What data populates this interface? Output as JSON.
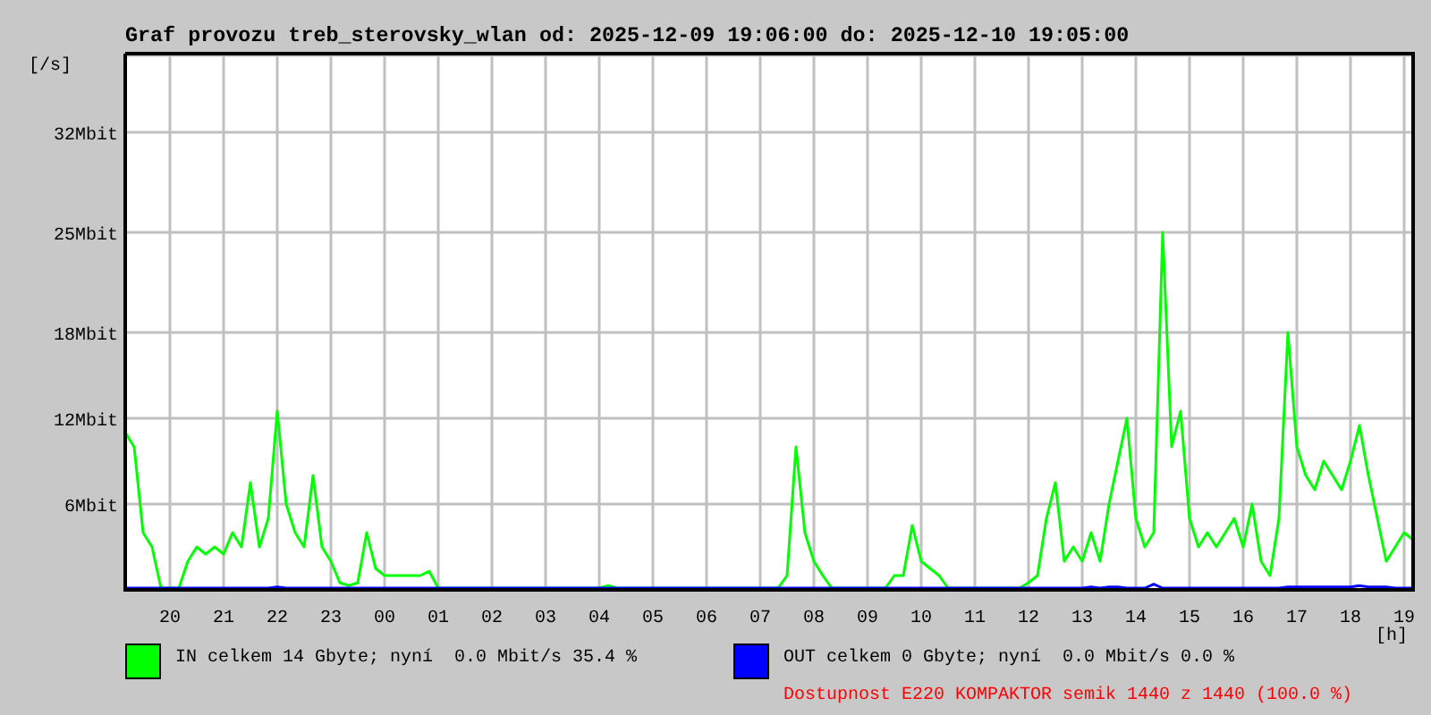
{
  "title": "Graf provozu treb_sterovsky_wlan od: 2025-12-09 19:06:00 do: 2025-12-10 19:05:00",
  "chart": {
    "chart_data": {
      "type": "line",
      "ylabel": "[/s]",
      "xlabel": "[h]",
      "ylim": [
        0,
        37.5
      ],
      "grid": true,
      "yticks": [
        {
          "value": 6,
          "label": "6Mbit"
        },
        {
          "value": 12,
          "label": "12Mbit"
        },
        {
          "value": 18,
          "label": "18Mbit"
        },
        {
          "value": 25,
          "label": "25Mbit"
        },
        {
          "value": 32,
          "label": "32Mbit"
        }
      ],
      "categories": [
        null,
        null,
        null,
        null,
        null,
        "20",
        null,
        null,
        null,
        null,
        null,
        "21",
        null,
        null,
        null,
        null,
        null,
        "22",
        null,
        null,
        null,
        null,
        null,
        "23",
        null,
        null,
        null,
        null,
        null,
        "00",
        null,
        null,
        null,
        null,
        null,
        "01",
        null,
        null,
        null,
        null,
        null,
        "02",
        null,
        null,
        null,
        null,
        null,
        "03",
        null,
        null,
        null,
        null,
        null,
        "04",
        null,
        null,
        null,
        null,
        null,
        "05",
        null,
        null,
        null,
        null,
        null,
        "06",
        null,
        null,
        null,
        null,
        null,
        "07",
        null,
        null,
        null,
        null,
        null,
        "08",
        null,
        null,
        null,
        null,
        null,
        "09",
        null,
        null,
        null,
        null,
        null,
        "10",
        null,
        null,
        null,
        null,
        null,
        "11",
        null,
        null,
        null,
        null,
        null,
        "12",
        null,
        null,
        null,
        null,
        null,
        "13",
        null,
        null,
        null,
        null,
        null,
        "14",
        null,
        null,
        null,
        null,
        null,
        "15",
        null,
        null,
        null,
        null,
        null,
        "16",
        null,
        null,
        null,
        null,
        null,
        "17",
        null,
        null,
        null,
        null,
        null,
        "18",
        null,
        null,
        null,
        null,
        null,
        "19",
        null
      ],
      "series": [
        {
          "name": "IN",
          "color": "#00ff00",
          "values": [
            11,
            10,
            4,
            3,
            0,
            0,
            0,
            2,
            3,
            2.5,
            3,
            2.5,
            4,
            3,
            7.5,
            3,
            5,
            12.5,
            6,
            4,
            3,
            8,
            3,
            2,
            0.5,
            0.3,
            0.5,
            4,
            1.5,
            1,
            1,
            1,
            1,
            1,
            1.3,
            0,
            0,
            0,
            0,
            0,
            0,
            0,
            0,
            0,
            0,
            0,
            0,
            0,
            0,
            0,
            0,
            0,
            0,
            0,
            0.3,
            0,
            0,
            0,
            0,
            0,
            0,
            0,
            0,
            0,
            0,
            0,
            0,
            0,
            0,
            0,
            0,
            0,
            0,
            0,
            1,
            10,
            4,
            2,
            1,
            0,
            0,
            0,
            0,
            0,
            0,
            0,
            1,
            1,
            4.5,
            2,
            1.5,
            1,
            0,
            0,
            0,
            0,
            0,
            0,
            0,
            0,
            0,
            0.5,
            1,
            5,
            7.5,
            2,
            3,
            2,
            4,
            2,
            6,
            9,
            12,
            5,
            3,
            4,
            25,
            10,
            12.5,
            5,
            3,
            4,
            3,
            4,
            5,
            3,
            6,
            2,
            1,
            5,
            18,
            10,
            8,
            7,
            9,
            8,
            7,
            9,
            11.5,
            8,
            5,
            2,
            3,
            4,
            3.5
          ]
        },
        {
          "name": "OUT",
          "color": "#0000ff",
          "values": [
            0.1,
            0,
            0,
            0,
            0,
            0,
            0,
            0,
            0.1,
            0,
            0,
            0,
            0,
            0,
            0,
            0.1,
            0,
            0.2,
            0.1,
            0,
            0,
            0,
            0,
            0,
            0,
            0,
            0,
            0,
            0,
            0,
            0,
            0,
            0,
            0,
            0,
            0,
            0,
            0,
            0,
            0,
            0,
            0,
            0,
            0,
            0,
            0,
            0,
            0,
            0,
            0,
            0,
            0,
            0,
            0,
            0,
            0,
            0,
            0,
            0,
            0,
            0,
            0,
            0,
            0,
            0,
            0,
            0,
            0,
            0,
            0,
            0,
            0,
            0,
            0,
            0,
            0.1,
            0,
            0,
            0,
            0,
            0,
            0,
            0,
            0,
            0,
            0,
            0.1,
            0,
            0.1,
            0,
            0,
            0,
            0,
            0,
            0,
            0,
            0,
            0,
            0,
            0,
            0,
            0,
            0,
            0,
            0,
            0,
            0,
            0.1,
            0.2,
            0.1,
            0.2,
            0.2,
            0,
            0,
            0,
            0.4,
            0,
            0,
            0,
            0,
            0,
            0,
            0,
            0,
            0,
            0,
            0,
            0,
            0,
            0,
            0.2,
            0.2,
            0.2,
            0.2,
            0.2,
            0.2,
            0.2,
            0.2,
            0.3,
            0.2,
            0.2,
            0.2,
            0,
            0,
            0
          ]
        }
      ]
    }
  },
  "legend": [
    {
      "text": "celkem 14 Gbyte; nyní  0.0 Mbit/s 35.4 %"
    },
    {
      "text": "celkem 0 Gbyte; nyní  0.0 Mbit/s 0.0 %"
    }
  ],
  "availability": "Dostupnost E220 KOMPAKTOR semik 1440 z 1440 (100.0 %)"
}
